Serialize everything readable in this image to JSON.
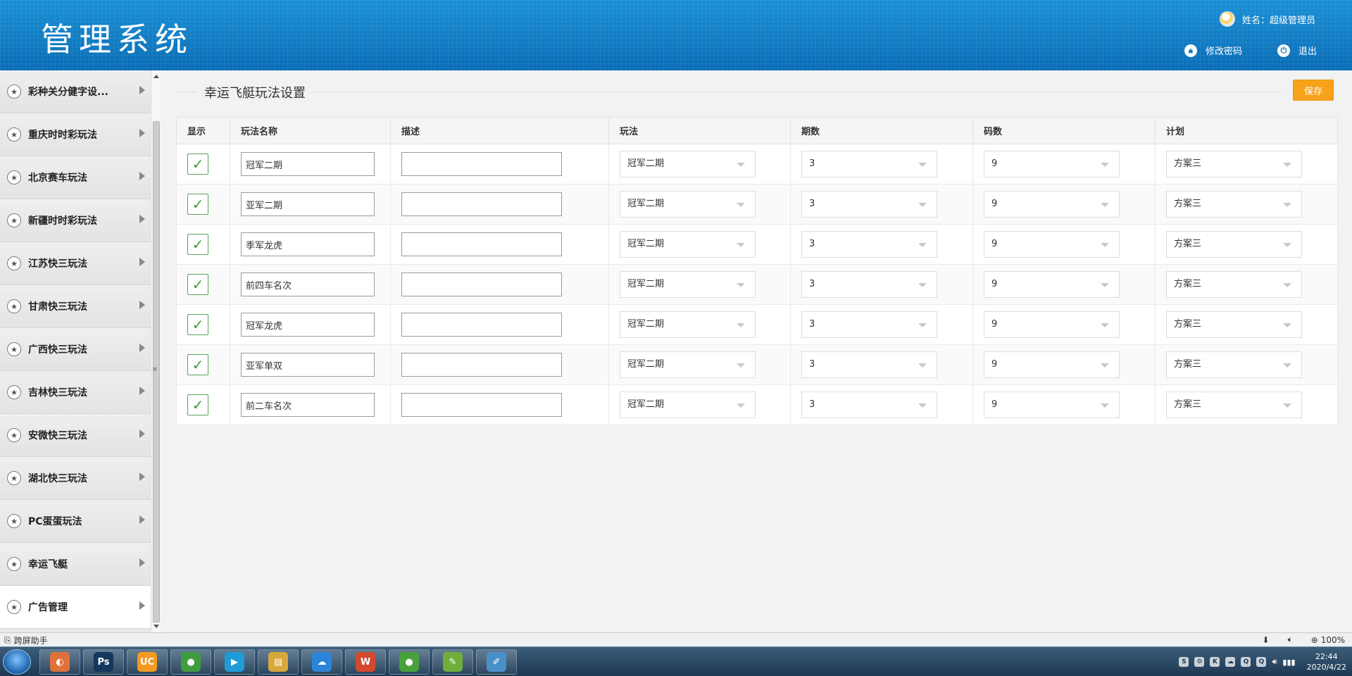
{
  "header": {
    "title": "管理系统",
    "user_label": "姓名：超级管理员",
    "change_password": "修改密码",
    "logout": "退出"
  },
  "sidebar": {
    "items": [
      {
        "label": "彩种关分健字设..."
      },
      {
        "label": "重庆时时彩玩法"
      },
      {
        "label": "北京赛车玩法"
      },
      {
        "label": "新疆时时彩玩法"
      },
      {
        "label": "江苏快三玩法"
      },
      {
        "label": "甘肃快三玩法"
      },
      {
        "label": "广西快三玩法"
      },
      {
        "label": "吉林快三玩法"
      },
      {
        "label": "安微快三玩法"
      },
      {
        "label": "湖北快三玩法"
      },
      {
        "label": "PC蛋蛋玩法"
      },
      {
        "label": "幸运飞艇"
      },
      {
        "label": "广告管理"
      }
    ]
  },
  "main": {
    "section_title": "幸运飞艇玩法设置",
    "save_label": "保存",
    "columns": [
      "显示",
      "玩法名称",
      "描述",
      "玩法",
      "期数",
      "码数",
      "计划"
    ],
    "rows": [
      {
        "name": "冠军二期",
        "desc": "",
        "play": "冠军二期",
        "periods": "3",
        "codes": "9",
        "plan": "方案三"
      },
      {
        "name": "亚军二期",
        "desc": "",
        "play": "冠军二期",
        "periods": "3",
        "codes": "9",
        "plan": "方案三"
      },
      {
        "name": "季军龙虎",
        "desc": "",
        "play": "冠军二期",
        "periods": "3",
        "codes": "9",
        "plan": "方案三"
      },
      {
        "name": "前四车名次",
        "desc": "",
        "play": "冠军二期",
        "periods": "3",
        "codes": "9",
        "plan": "方案三"
      },
      {
        "name": "冠军龙虎",
        "desc": "",
        "play": "冠军二期",
        "periods": "3",
        "codes": "9",
        "plan": "方案三"
      },
      {
        "name": "亚军单双",
        "desc": "",
        "play": "冠军二期",
        "periods": "3",
        "codes": "9",
        "plan": "方案三"
      },
      {
        "name": "前二车名次",
        "desc": "",
        "play": "冠军二期",
        "periods": "3",
        "codes": "9",
        "plan": "方案三"
      }
    ]
  },
  "statusbar": {
    "left_label": "跨屏助手",
    "zoom": "100%"
  },
  "taskbar": {
    "apps": [
      {
        "icon": "chrome-like-icon",
        "glyph": "◐",
        "color": "#e0713a"
      },
      {
        "icon": "photoshop-icon",
        "glyph": "Ps",
        "color": "#14385f"
      },
      {
        "icon": "uc-browser-icon",
        "glyph": "UC",
        "color": "#f39a22"
      },
      {
        "icon": "chrome-icon",
        "glyph": "●",
        "color": "#3f9c3f"
      },
      {
        "icon": "media-player-icon",
        "glyph": "▶",
        "color": "#1f9bd8"
      },
      {
        "icon": "folder-icon",
        "glyph": "▤",
        "color": "#d9a83a"
      },
      {
        "icon": "cloud-icon",
        "glyph": "☁",
        "color": "#2c84d9"
      },
      {
        "icon": "wps-icon",
        "glyph": "W",
        "color": "#d4492e"
      },
      {
        "icon": "green-app-icon",
        "glyph": "●",
        "color": "#48a13a"
      },
      {
        "icon": "chart-app-icon",
        "glyph": "✎",
        "color": "#6fae3b"
      },
      {
        "icon": "notebook-icon",
        "glyph": "✐",
        "color": "#4a90c8"
      }
    ],
    "time": "22:44",
    "date": "2020/4/22"
  }
}
